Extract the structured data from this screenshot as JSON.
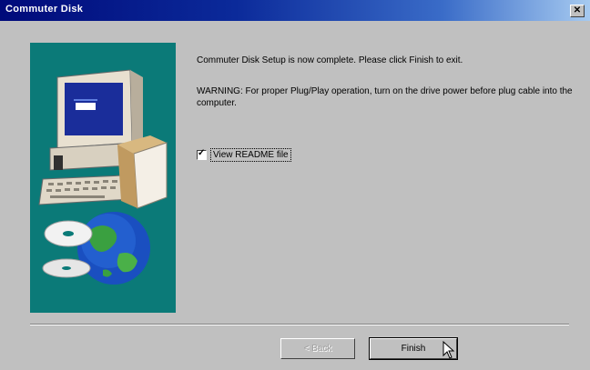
{
  "window": {
    "title": "Commuter Disk"
  },
  "messages": {
    "complete": "Commuter Disk Setup is now complete. Please click Finish to exit.",
    "warning": "WARNING: For proper Plug/Play operation, turn on the drive power before plug cable into the computer."
  },
  "readme": {
    "label": "View README file",
    "checked": true
  },
  "buttons": {
    "back": "< Back",
    "finish": "Finish"
  }
}
